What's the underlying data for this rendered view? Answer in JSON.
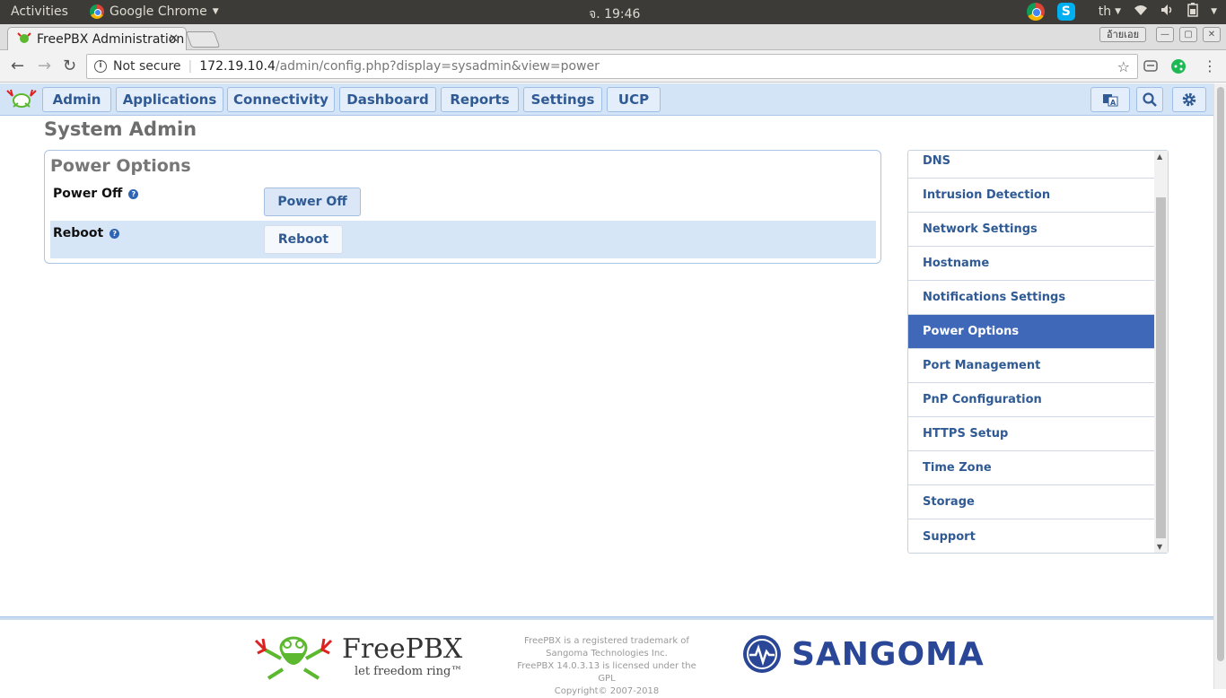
{
  "os": {
    "activities": "Activities",
    "app_name": "Google Chrome",
    "clock": "จ. 19:46",
    "lang": "th"
  },
  "browser": {
    "tab_title": "FreePBX Administration",
    "profile": "อ้ายเอย",
    "security": "Not secure",
    "url_host": "172.19.10.4",
    "url_path": "/admin/config.php?display=sysadmin&view=power"
  },
  "nav": {
    "items": [
      "Admin",
      "Applications",
      "Connectivity",
      "Dashboard",
      "Reports",
      "Settings",
      "UCP"
    ]
  },
  "page": {
    "title": "System Admin",
    "panel_title": "Power Options",
    "rows": [
      {
        "label": "Power Off",
        "button": "Power Off"
      },
      {
        "label": "Reboot",
        "button": "Reboot"
      }
    ]
  },
  "sidemenu": {
    "items": [
      "DNS",
      "Intrusion Detection",
      "Network Settings",
      "Hostname",
      "Notifications Settings",
      "Power Options",
      "Port Management",
      "PnP Configuration",
      "HTTPS Setup",
      "Time Zone",
      "Storage",
      "Support"
    ],
    "active": "Power Options"
  },
  "footer": {
    "brand": "FreePBX",
    "slogan": "let freedom ring™",
    "line1": "FreePBX is a registered trademark of",
    "line2": "Sangoma Technologies Inc.",
    "line3": "FreePBX 14.0.3.13 is licensed under the GPL",
    "line4": "Copyright© 2007-2018",
    "sangoma": "SANGOMA"
  },
  "colors": {
    "nav_bg": "#d3e4f7",
    "accent": "#2f5a94",
    "active_menu": "#4068b8"
  }
}
